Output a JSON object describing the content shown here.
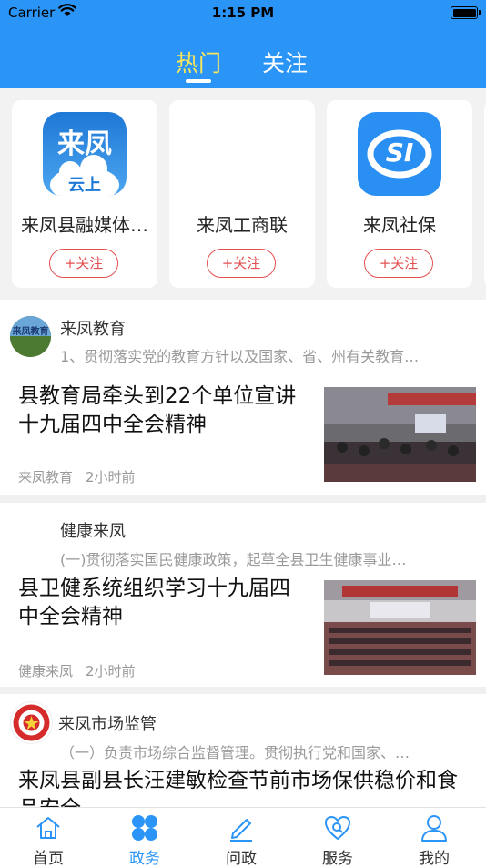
{
  "status_bar": {
    "carrier": "Carrier",
    "time": "1:15 PM"
  },
  "header": {
    "tabs": [
      {
        "label": "热门",
        "active": true
      },
      {
        "label": "关注",
        "active": false
      }
    ]
  },
  "accounts": [
    {
      "name": "来凤县融媒体…",
      "follow_label": "+关注",
      "logo_text_top": "来凤",
      "logo_text_bottom": "云上"
    },
    {
      "name": "来凤工商联",
      "follow_label": "+关注"
    },
    {
      "name": "来凤社保",
      "follow_label": "+关注",
      "logo_text": "SI"
    }
  ],
  "feed": [
    {
      "source": "来凤教育",
      "avatar_text": "来凤教育",
      "description": "1、贯彻落实党的教育方针以及国家、省、州有关教育…",
      "title": "县教育局牵头到22个单位宣讲十九届四中全会精神",
      "meta_source": "来凤教育",
      "time": "2小时前"
    },
    {
      "source": "健康来凤",
      "description": "(一)贯彻落实国民健康政策，起草全县卫生健康事业…",
      "title": "县卫健系统组织学习十九届四中全会精神",
      "meta_source": "健康来凤",
      "time": "2小时前"
    },
    {
      "source": "来凤市场监管",
      "description": "（一）负责市场综合监督管理。贯彻执行党和国家、…",
      "title": "来凤县副县长汪建敏检查节前市场保供稳价和食品安全"
    }
  ],
  "tab_bar": [
    {
      "label": "首页",
      "active": false,
      "icon": "home-icon"
    },
    {
      "label": "政务",
      "active": true,
      "icon": "grid-icon"
    },
    {
      "label": "问政",
      "active": false,
      "icon": "pencil-icon"
    },
    {
      "label": "服务",
      "active": false,
      "icon": "heart-search-icon"
    },
    {
      "label": "我的",
      "active": false,
      "icon": "person-icon"
    }
  ],
  "colors": {
    "header_blue": "#2b94f7",
    "active_tab_yellow": "#fbe85a",
    "follow_red": "#e25050"
  }
}
